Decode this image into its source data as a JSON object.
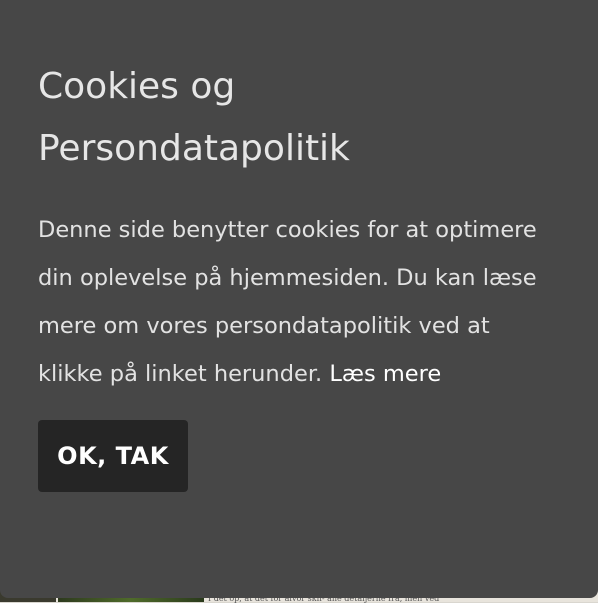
{
  "dialog": {
    "title": "Cookies og Persondatapolitik",
    "text": "Denne side benytter cookies for at optimere din oplevelse på hjemmesiden. Du kan læse mere om vores persondatapolitik ved at klikke på linket herunder.",
    "link_label": "Læs mere",
    "button_label": "OK, TAK"
  },
  "background": {
    "visible_text": "I det op, at det for alvor skif-   ane detaljerne fra, men ved"
  },
  "colors": {
    "dialog_bg": "#474747",
    "button_bg": "#252525",
    "text": "#e2e2e2",
    "link": "#ffffff"
  }
}
